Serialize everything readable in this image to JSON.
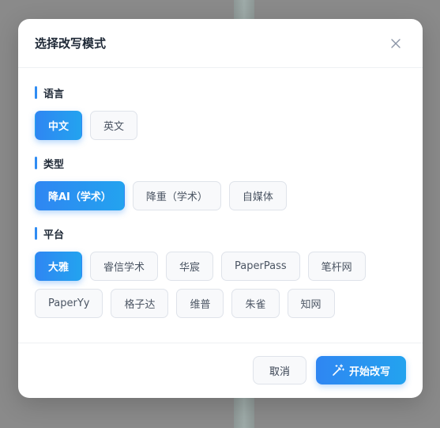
{
  "modal": {
    "title": "选择改写模式",
    "close_icon": "close-icon"
  },
  "sections": {
    "language": {
      "title": "语言",
      "options": [
        "中文",
        "英文"
      ],
      "selected": "中文"
    },
    "type": {
      "title": "类型",
      "options": [
        "降AI（学术）",
        "降重（学术）",
        "自媒体"
      ],
      "selected": "降AI（学术）"
    },
    "platform": {
      "title": "平台",
      "options": [
        "大雅",
        "睿信学术",
        "华宸",
        "PaperPass",
        "笔杆网",
        "PaperYy",
        "格子达",
        "维普",
        "朱雀",
        "知网"
      ],
      "selected": "大雅"
    }
  },
  "footer": {
    "cancel_label": "取消",
    "start_label": "开始改写",
    "start_icon": "magic-wand-icon"
  },
  "colors": {
    "accent": "#2f8cf3",
    "accent_gradient_end": "#23a3ef"
  }
}
